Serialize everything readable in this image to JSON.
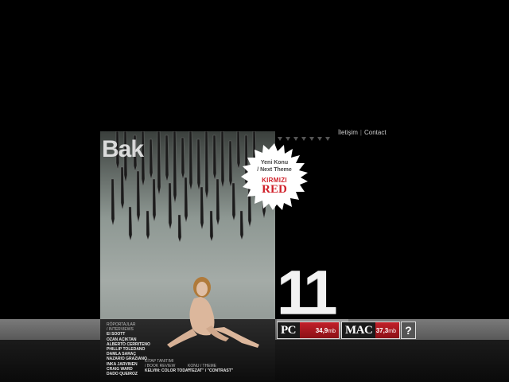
{
  "nav": {
    "contact_tr": "İletişim",
    "separator": "|",
    "contact_en": "Contact"
  },
  "cover": {
    "logo": "Bak",
    "interviews_heading_tr": "RÖPORTAJLAR",
    "interviews_heading_en": "/ INTERVIEWS",
    "interviews": [
      "EI SOOTT",
      "OZAN AÇIKTAN",
      "ALBERTO CERRITENO",
      "PHILLIP TOLEDANO",
      "DAMLA SARAÇ",
      "NAZARIO GRAZIANO",
      "INKA JARVINEN",
      "CRAIG WARD",
      "DADO QUEIROZ"
    ],
    "book_heading_tr": "KİTAP TANITIMI",
    "book_heading_en": "/ BOOK REVIEW",
    "book_title": "KELVIN: COLOR TODAY",
    "theme_heading_tr": "KONU / THEME",
    "theme_title": "\"TEZAT\" / \"CONTRAST\""
  },
  "badge": {
    "line1": "Yeni Konu",
    "line2": "/ Next Theme",
    "line3": "KIRMIZI",
    "line4": "RED",
    "accent": "#d0202a"
  },
  "issue_number": "11",
  "downloads": {
    "pc": {
      "label": "PC",
      "size": "34,9",
      "unit": "mb"
    },
    "mac": {
      "label": "MAC",
      "size": "37,3",
      "unit": "mb"
    },
    "help": "?"
  },
  "colors": {
    "background": "#000000",
    "band": "#6a6a6a",
    "download_red": "#b01a22"
  }
}
